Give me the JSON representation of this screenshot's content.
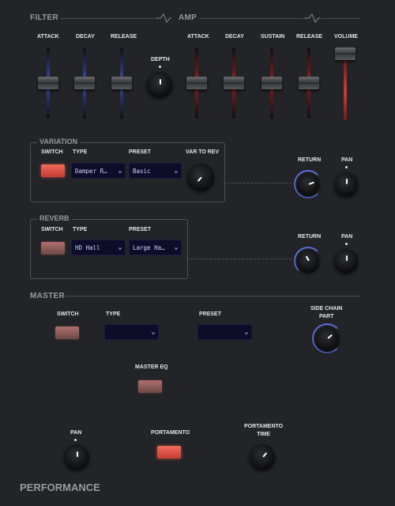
{
  "header": {
    "filter_title": "FILTER",
    "amp_title": "AMP",
    "filter": {
      "attack": "ATTACK",
      "decay": "DECAY",
      "release": "RELEASE"
    },
    "depth": "DEPTH",
    "amp": {
      "attack": "ATTACK",
      "decay": "DECAY",
      "sustain": "SUSTAIN",
      "release": "RELEASE",
      "volume": "VOLUME"
    }
  },
  "variation": {
    "title": "VARIATION",
    "switch_label": "SWITCH",
    "type_label": "TYPE",
    "preset_label": "PRESET",
    "var_to_rev_label": "VAR TO REV",
    "type_value": "Damper R…",
    "preset_value": "Basic",
    "return_label": "RETURN",
    "pan_label": "PAN"
  },
  "reverb": {
    "title": "REVERB",
    "switch_label": "SWITCH",
    "type_label": "TYPE",
    "preset_label": "PRESET",
    "type_value": "HD Hall",
    "preset_value": "Large Ha…",
    "return_label": "RETURN",
    "pan_label": "PAN"
  },
  "master": {
    "title": "MASTER",
    "switch_label": "SWITCH",
    "type_label": "TYPE",
    "preset_label": "PRESET",
    "type_value": "",
    "preset_value": "",
    "side_chain_label": "SIDE CHAIN\nPART",
    "master_eq_label": "MASTER EQ"
  },
  "bottom": {
    "pan_label": "PAN",
    "portamento_label": "PORTAMENTO",
    "portamento_time_label": "PORTAMENTO\nTIME"
  },
  "footer": {
    "title": "PERFORMANCE"
  },
  "colors": {
    "accent_blue": "#5b6fd6",
    "accent_red": "#e0483f",
    "select_bg": "#0d0d2a"
  }
}
